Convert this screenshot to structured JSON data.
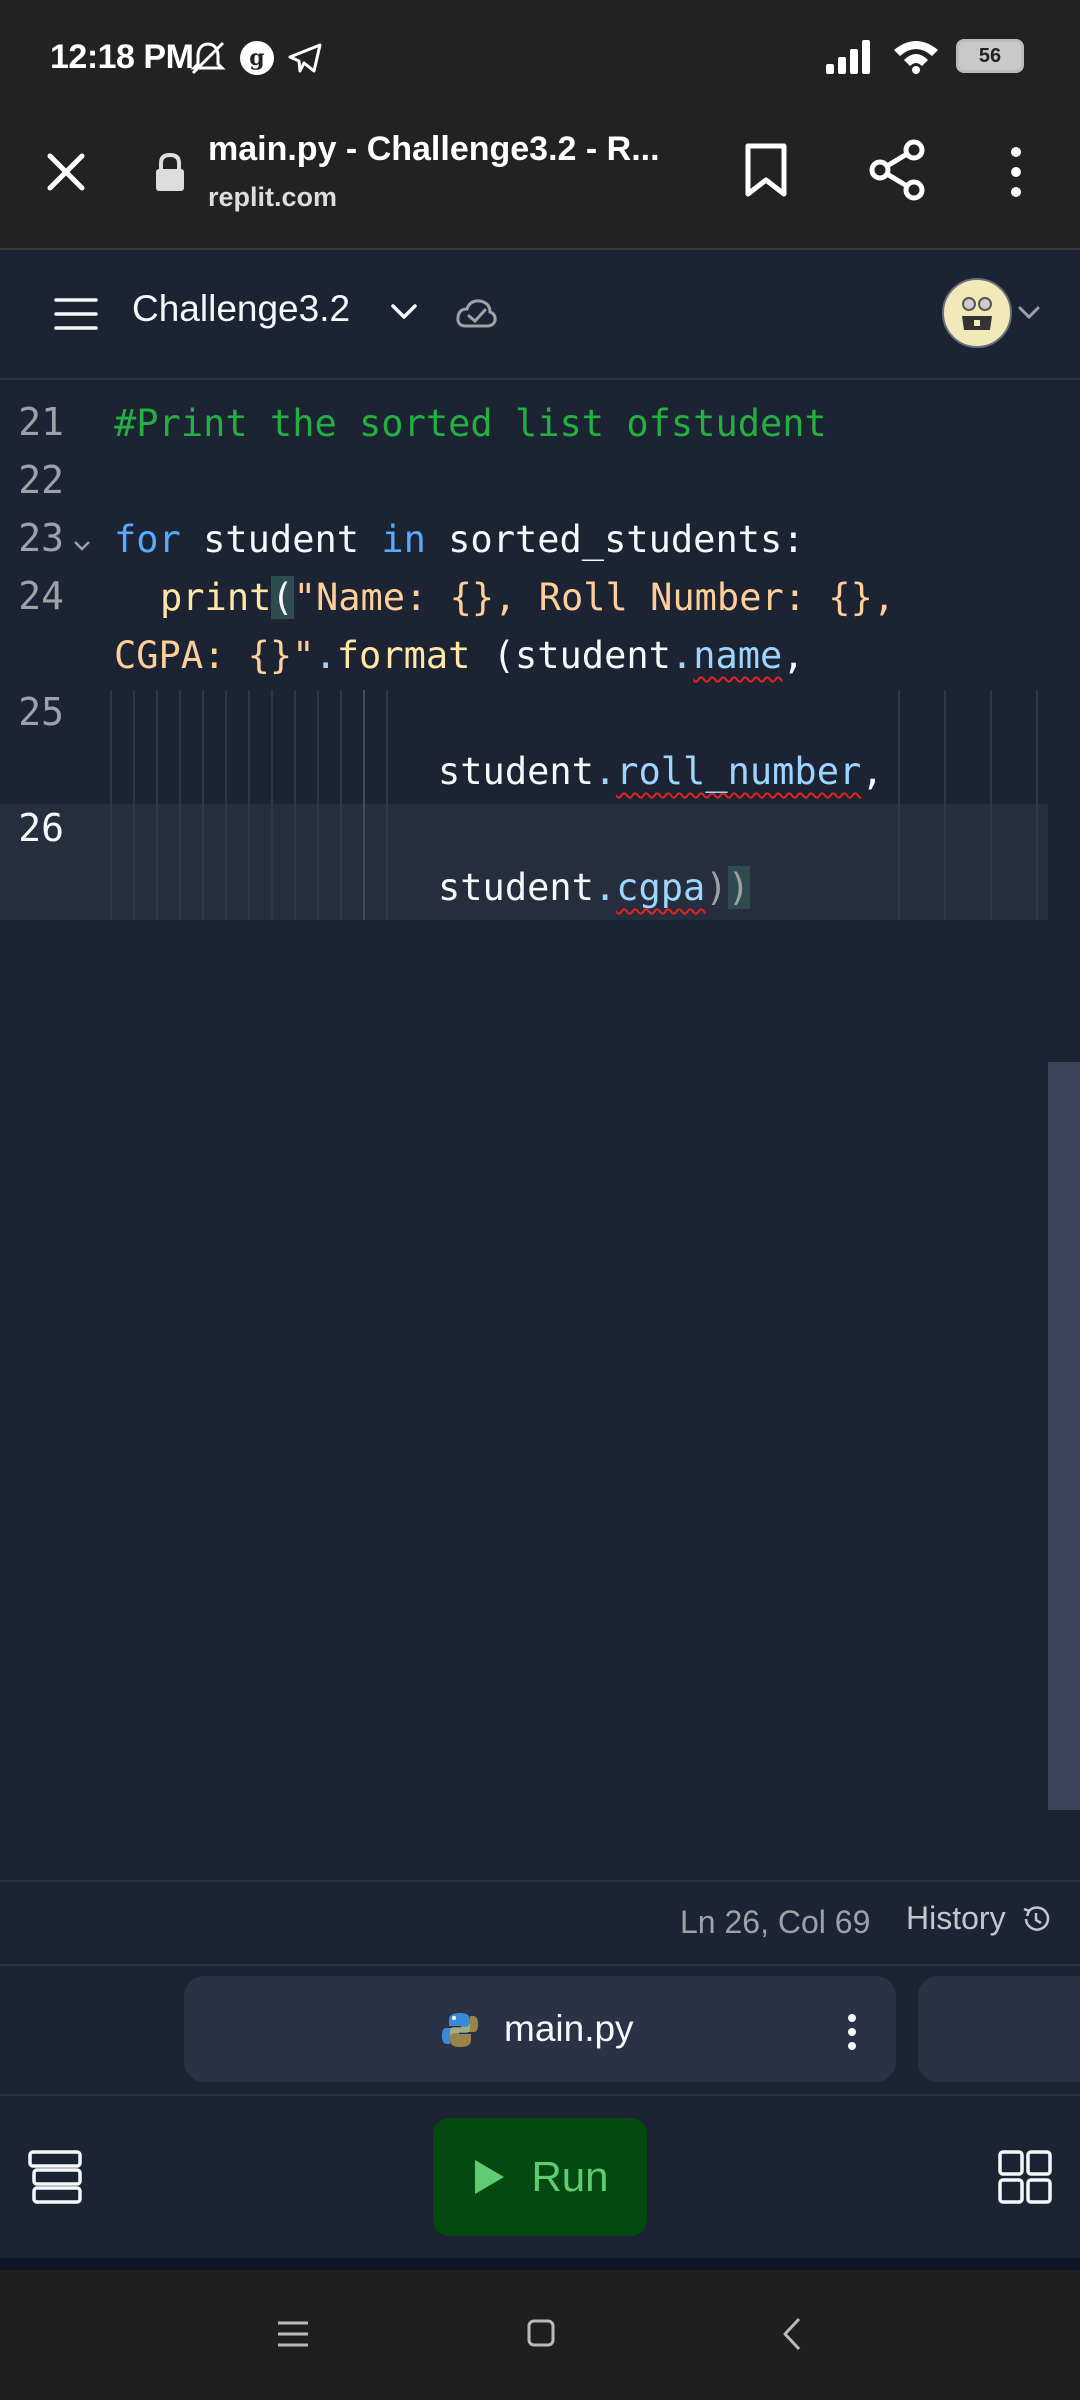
{
  "status_bar": {
    "time": "12:18 PM",
    "icons_left": [
      "mute-icon",
      "g-icon",
      "telegram-icon"
    ],
    "icons_right": [
      "signal-icon",
      "wifi-icon",
      "battery-icon"
    ],
    "battery_level": "56"
  },
  "browser": {
    "title": "main.py - Challenge3.2 - R...",
    "domain": "replit.com",
    "icons": [
      "close-icon",
      "lock-icon",
      "bookmark-icon",
      "share-icon",
      "more-vert-icon"
    ]
  },
  "header": {
    "project_name": "Challenge3.2"
  },
  "editor": {
    "line_numbers": [
      "21",
      "22",
      "23",
      "24",
      "25",
      "26"
    ],
    "active_line": "26",
    "code": {
      "l21_comment": "#Print the sorted list ofstudent",
      "l23_for": "for",
      "l23_var": " student ",
      "l23_in": "in",
      "l23_iter": " sorted_students:",
      "l24_print": "print",
      "l24_paren": "(",
      "l24_string": "\"Name: {}, Roll Number: {},",
      "l24b_string": "CGPA: {}\"",
      "l24b_dot": ".",
      "l24b_format": "format",
      "l24b_open": " (student",
      "l24b_dot2": ".",
      "l24b_attr": "name",
      "l24b_comma": ",",
      "l25_obj": "student",
      "l25_dot": ".",
      "l25_attr": "roll_number",
      "l25_comma": ",",
      "l26_obj": "student",
      "l26_dot": ".",
      "l26_attr": "cgpa",
      "l26_close1": ")",
      "l26_close2": ")"
    }
  },
  "status_line": {
    "cursor": "Ln 26, Col 69",
    "history_label": "History"
  },
  "tabs": [
    {
      "label": "main.py",
      "icon": "python-icon",
      "active": true
    }
  ],
  "toolbar": {
    "run_label": "Run"
  },
  "colors": {
    "background": "#1c2333",
    "keyword": "#57abff",
    "comment": "#23b041",
    "string": "#ffcf99",
    "run_button": "#044a10",
    "run_text": "#5fcc73"
  }
}
